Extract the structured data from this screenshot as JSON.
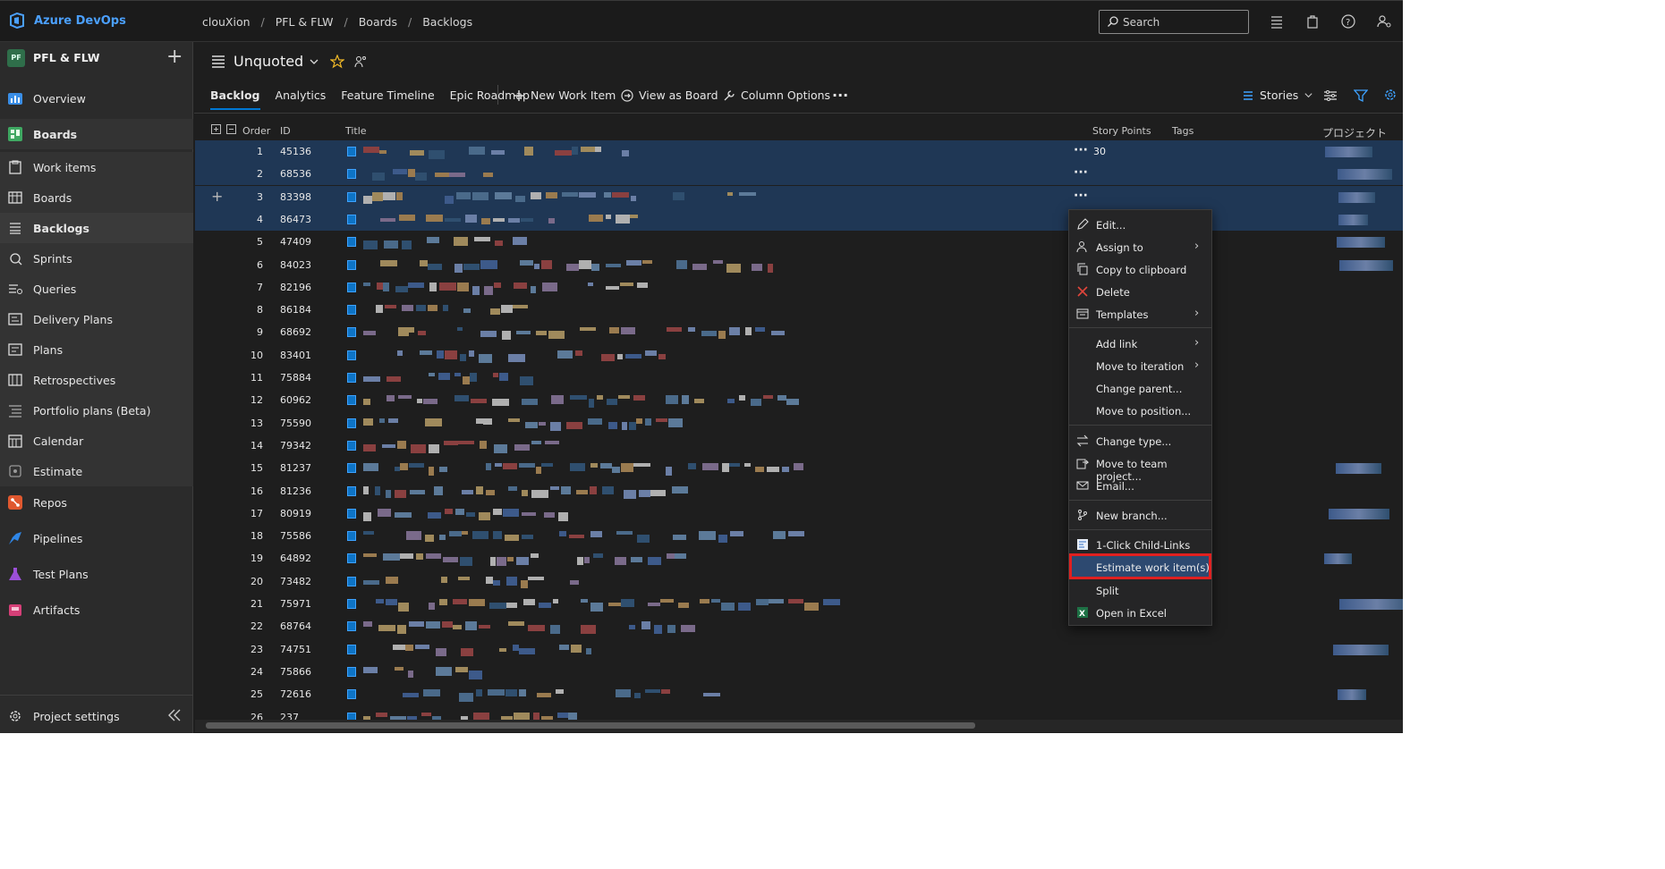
{
  "app": {
    "brand": "Azure DevOps"
  },
  "breadcrumb": [
    "clouXion",
    "PFL & FLW",
    "Boards",
    "Backlogs"
  ],
  "search": {
    "placeholder": "Search"
  },
  "project": {
    "badge": "PF",
    "name": "PFL & FLW"
  },
  "sidebar": {
    "items": [
      {
        "label": "Overview",
        "icon": "overview-icon"
      },
      {
        "label": "Boards",
        "icon": "boards-icon"
      },
      {
        "label": "Work items",
        "icon": "work-items-icon"
      },
      {
        "label": "Boards",
        "icon": "kanban-icon"
      },
      {
        "label": "Backlogs",
        "icon": "backlogs-icon"
      },
      {
        "label": "Sprints",
        "icon": "sprints-icon"
      },
      {
        "label": "Queries",
        "icon": "queries-icon"
      },
      {
        "label": "Delivery Plans",
        "icon": "delivery-plans-icon"
      },
      {
        "label": "Plans",
        "icon": "plans-icon"
      },
      {
        "label": "Retrospectives",
        "icon": "retrospectives-icon"
      },
      {
        "label": "Portfolio plans (Beta)",
        "icon": "portfolio-icon"
      },
      {
        "label": "Calendar",
        "icon": "calendar-icon"
      },
      {
        "label": "Estimate",
        "icon": "estimate-icon"
      },
      {
        "label": "Repos",
        "icon": "repos-icon"
      },
      {
        "label": "Pipelines",
        "icon": "pipelines-icon"
      },
      {
        "label": "Test Plans",
        "icon": "test-plans-icon"
      },
      {
        "label": "Artifacts",
        "icon": "artifacts-icon"
      }
    ],
    "settings": "Project settings"
  },
  "header": {
    "title": "Unquoted"
  },
  "tabs": [
    "Backlog",
    "Analytics",
    "Feature Timeline",
    "Epic Roadmap"
  ],
  "commands": {
    "new_item": "New Work Item",
    "view_board": "View as Board",
    "column_options": "Column Options",
    "level": "Stories"
  },
  "columns": {
    "order": "Order",
    "id": "ID",
    "title": "Title",
    "story_points": "Story Points",
    "tags": "Tags",
    "project": "プロジェクト"
  },
  "rows": [
    {
      "order": "1",
      "id": "45136",
      "sp": "30"
    },
    {
      "order": "2",
      "id": "68536",
      "sp": ""
    },
    {
      "order": "3",
      "id": "83398",
      "sp": ""
    },
    {
      "order": "4",
      "id": "86473",
      "sp": ""
    },
    {
      "order": "5",
      "id": "47409",
      "sp": ""
    },
    {
      "order": "6",
      "id": "84023",
      "sp": ""
    },
    {
      "order": "7",
      "id": "82196",
      "sp": ""
    },
    {
      "order": "8",
      "id": "86184",
      "sp": ""
    },
    {
      "order": "9",
      "id": "68692",
      "sp": ""
    },
    {
      "order": "10",
      "id": "83401",
      "sp": ""
    },
    {
      "order": "11",
      "id": "75884",
      "sp": ""
    },
    {
      "order": "12",
      "id": "60962",
      "sp": ""
    },
    {
      "order": "13",
      "id": "75590",
      "sp": ""
    },
    {
      "order": "14",
      "id": "79342",
      "sp": ""
    },
    {
      "order": "15",
      "id": "81237",
      "sp": ""
    },
    {
      "order": "16",
      "id": "81236",
      "sp": ""
    },
    {
      "order": "17",
      "id": "80919",
      "sp": ""
    },
    {
      "order": "18",
      "id": "75586",
      "sp": ""
    },
    {
      "order": "19",
      "id": "64892",
      "sp": ""
    },
    {
      "order": "20",
      "id": "73482",
      "sp": ""
    },
    {
      "order": "21",
      "id": "75971",
      "sp": ""
    },
    {
      "order": "22",
      "id": "68764",
      "sp": ""
    },
    {
      "order": "23",
      "id": "74751",
      "sp": ""
    },
    {
      "order": "24",
      "id": "75866",
      "sp": ""
    },
    {
      "order": "25",
      "id": "72616",
      "sp": ""
    },
    {
      "order": "26",
      "id": "237",
      "sp": ""
    }
  ],
  "context_menu": [
    {
      "label": "Edit...",
      "icon": "pencil-icon"
    },
    {
      "label": "Assign to",
      "icon": "person-icon",
      "submenu": true
    },
    {
      "label": "Copy to clipboard",
      "icon": "copy-icon"
    },
    {
      "label": "Delete",
      "icon": "delete-icon"
    },
    {
      "label": "Templates",
      "icon": "template-icon",
      "submenu": true
    },
    {
      "label": "Add link",
      "icon": "",
      "submenu": true
    },
    {
      "label": "Move to iteration",
      "icon": "",
      "submenu": true
    },
    {
      "label": "Change parent...",
      "icon": ""
    },
    {
      "label": "Move to position...",
      "icon": ""
    },
    {
      "label": "Change type...",
      "icon": "swap-icon"
    },
    {
      "label": "Move to team project...",
      "icon": "move-icon"
    },
    {
      "label": "Email...",
      "icon": "mail-icon"
    },
    {
      "label": "New branch...",
      "icon": "branch-icon"
    },
    {
      "label": "1-Click Child-Links",
      "icon": "child-links-icon"
    },
    {
      "label": "Estimate work item(s)",
      "icon": ""
    },
    {
      "label": "Split",
      "icon": ""
    },
    {
      "label": "Open in Excel",
      "icon": "excel-icon"
    }
  ],
  "colors": {
    "accent": "#0078d4",
    "selected_row": "#1f3755",
    "highlight_outline": "#e02020"
  }
}
